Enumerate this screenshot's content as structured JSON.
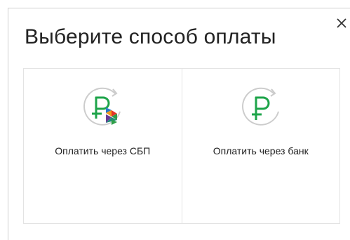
{
  "modal": {
    "title": "Выберите способ оплаты",
    "close_icon": "close-icon"
  },
  "options": [
    {
      "label": "Оплатить через СБП",
      "icon": "sbp-ruble-icon"
    },
    {
      "label": "Оплатить через банк",
      "icon": "ruble-icon"
    }
  ],
  "colors": {
    "ruble": "#1ea44a",
    "arc": "#cccccc",
    "sbp_green": "#2e9e48",
    "sbp_orange": "#f39a1b",
    "sbp_red": "#e4342a",
    "sbp_purple": "#6a3c96",
    "sbp_blue": "#2a7ac6",
    "sbp_teal": "#1f8a7a"
  }
}
